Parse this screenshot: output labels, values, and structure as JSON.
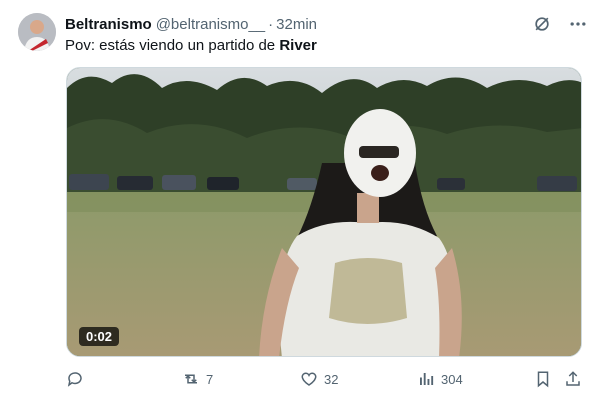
{
  "tweet": {
    "author_name": "Beltranismo",
    "author_handle": "@beltranismo__",
    "separator": "·",
    "timestamp": "32min",
    "text_prefix": "Pov: estás viendo un partido de ",
    "text_bold": "River",
    "video_duration": "0:02"
  },
  "actions": {
    "reply_count": "",
    "retweet_count": "7",
    "like_count": "32",
    "views_count": "304"
  },
  "icons": {
    "grok": "grok-icon",
    "more": "more-icon",
    "reply": "reply-icon",
    "retweet": "retweet-icon",
    "like": "heart-icon",
    "views": "views-icon",
    "bookmark": "bookmark-icon",
    "share": "share-icon"
  },
  "colors": {
    "text": "#0f1419",
    "secondary": "#536471"
  }
}
